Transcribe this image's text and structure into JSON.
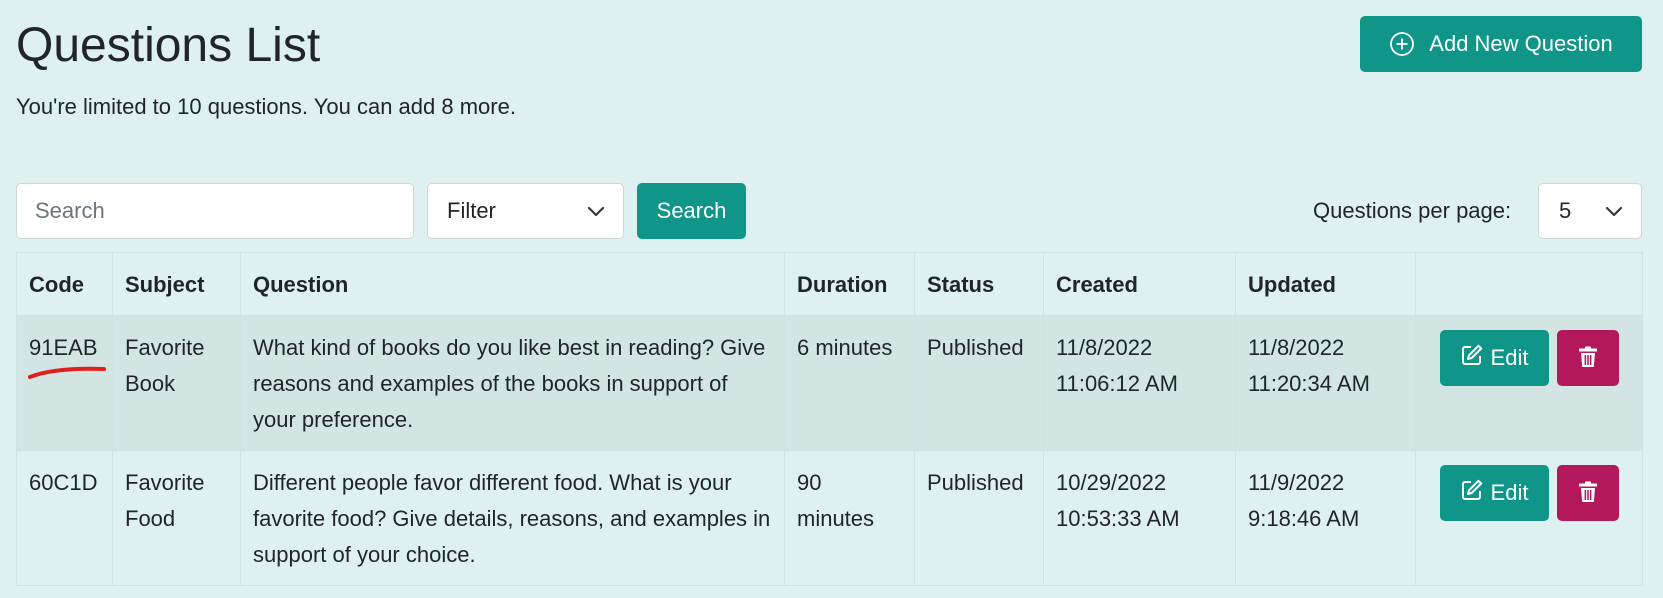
{
  "page": {
    "title": "Questions List",
    "subtitle": "You're limited to 10 questions. You can add 8 more.",
    "add_button": "Add New Question"
  },
  "toolbar": {
    "search_placeholder": "Search",
    "filter_value": "Filter",
    "search_button": "Search",
    "per_page_label": "Questions per page:",
    "per_page_value": "5"
  },
  "table": {
    "headers": [
      "Code",
      "Subject",
      "Question",
      "Duration",
      "Status",
      "Created",
      "Updated",
      ""
    ],
    "rows": [
      {
        "code": "91EAB",
        "subject": "Favorite Book",
        "question": "What kind of books do you like best in reading? Give reasons and examples of the books in support of your preference.",
        "duration": "6 minutes",
        "status": "Published",
        "created_date": "11/8/2022",
        "created_time": "11:06:12 AM",
        "updated_date": "11/8/2022",
        "updated_time": "11:20:34 AM",
        "edit_label": "Edit"
      },
      {
        "code": "60C1D",
        "subject": "Favorite Food",
        "question": "Different people favor different food. What is your favorite food? Give details, reasons, and examples in support of your choice.",
        "duration": "90 minutes",
        "status": "Published",
        "created_date": "10/29/2022",
        "created_time": "10:53:33 AM",
        "updated_date": "11/9/2022",
        "updated_time": "9:18:46 AM",
        "edit_label": "Edit"
      }
    ]
  },
  "colors": {
    "background": "#dff0f0",
    "primary": "#0f9688",
    "danger": "#b3185a",
    "annotation": "#e0201c"
  },
  "icons": {
    "add": "plus-circle-icon",
    "filter_chevron": "chevron-down-icon",
    "edit": "edit-icon",
    "delete": "trash-icon"
  }
}
